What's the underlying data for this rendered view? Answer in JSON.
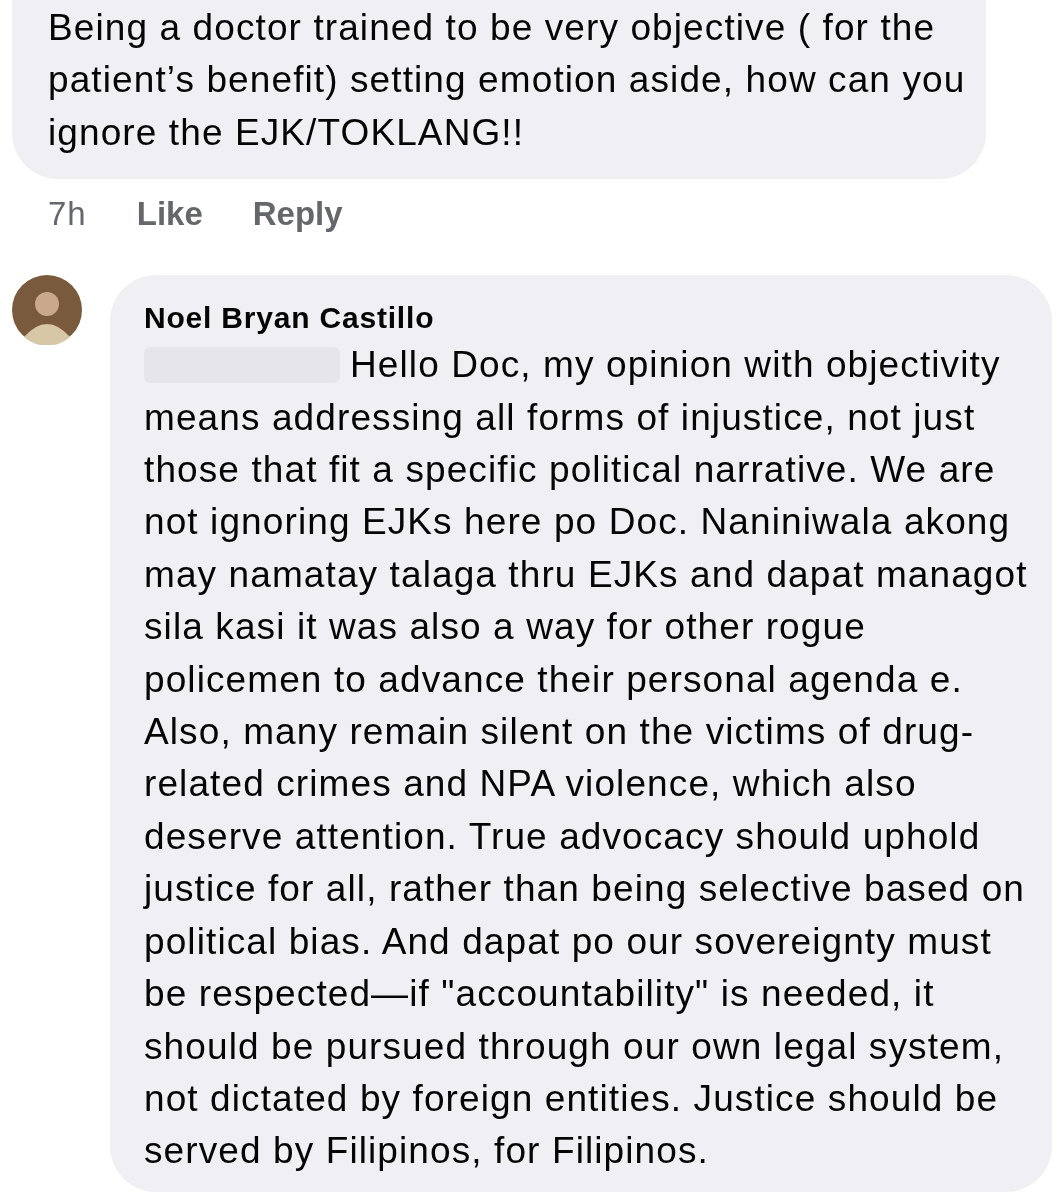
{
  "comments": [
    {
      "text": "Being a doctor trained to be very objective ( for the patient’s benefit) setting emotion aside, how can you ignore the EJK/TOKLANG!!",
      "time": "7h",
      "actions": [
        "Like",
        "Reply"
      ]
    },
    {
      "author": "Noel Bryan Castillo",
      "mention_redacted": true,
      "text": "Hello Doc, my opinion with objectivity means addressing all forms of injustice, not just those that fit a specific political narrative. We are not ignoring EJKs here po Doc. Naniniwala akong may namatay talaga thru EJKs and dapat managot sila kasi it was also a way for other rogue policemen to advance their personal agenda e. Also, many remain silent on the victims of drug-related crimes and NPA violence, which also deserve attention. True advocacy should uphold justice for all, rather than being selective based on political bias. And dapat po our sovereignty must be respected—if \"accountability\" is needed, it should be pursued through our own legal system, not dictated by foreign entities. Justice should be served by Filipinos, for Filipinos."
    }
  ]
}
